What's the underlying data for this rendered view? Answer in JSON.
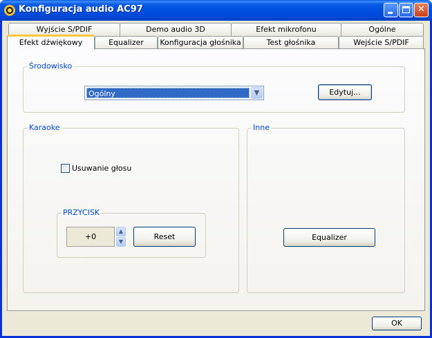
{
  "window": {
    "title": "Konfiguracja audio AC97"
  },
  "tabs": {
    "back_row": [
      "Wyjście S/PDIF",
      "Demo audio 3D",
      "Efekt mikrofonu",
      "Ogólne"
    ],
    "front_row": [
      "Efekt dźwiękowy",
      "Equalizer",
      "Konfiguracja głośnika",
      "Test głośnika",
      "Wejście S/PDIF"
    ],
    "active": "Efekt dźwiękowy"
  },
  "environment": {
    "group_title": "Środowisko",
    "selected": "Ogólny",
    "edit_button": "Edytuj..."
  },
  "karaoke": {
    "group_title": "Karaoke",
    "voice_removal_label": "Usuwanie głosu",
    "voice_removal_checked": false,
    "key": {
      "group_title": "PRZYCISK",
      "value": "+0",
      "reset_button": "Reset"
    }
  },
  "other": {
    "group_title": "Inne",
    "equalizer_button": "Equalizer"
  },
  "footer": {
    "ok_button": "OK"
  },
  "icons": {
    "title_icon": "speaker-icon",
    "combo_arrow": "chevron-down-icon",
    "spin_up": "chevron-up-icon",
    "spin_down": "chevron-down-icon"
  }
}
